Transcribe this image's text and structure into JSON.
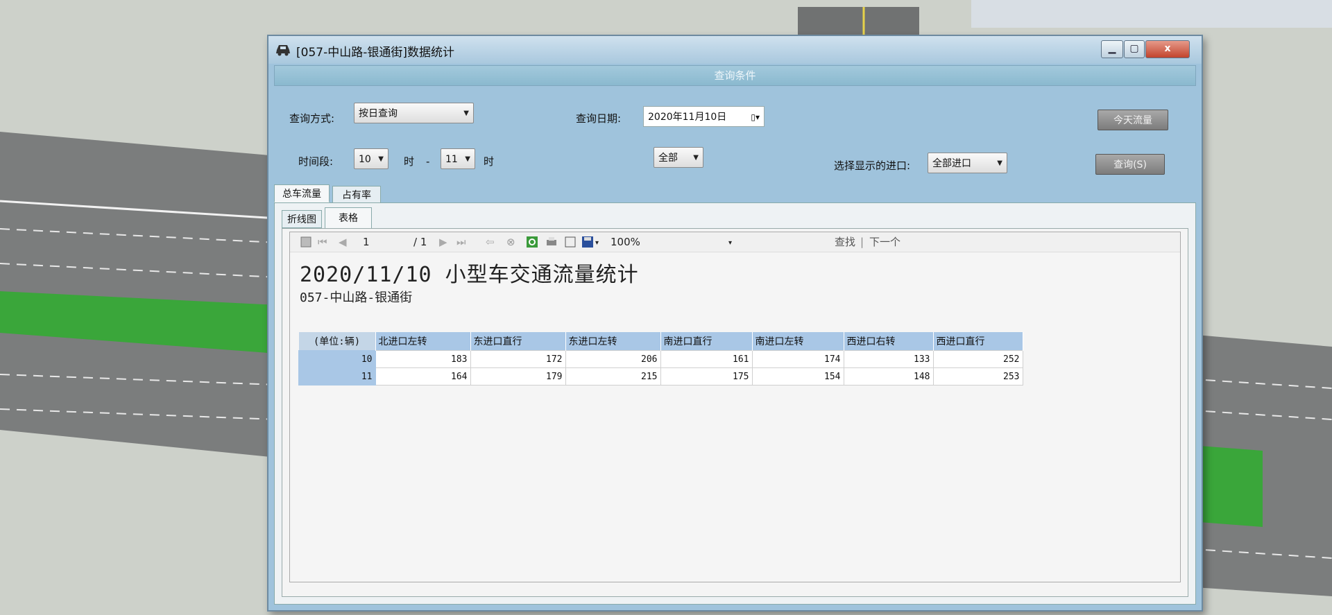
{
  "window": {
    "title": "[057-中山路-银通街]数据统计",
    "controls": {
      "minimize": "▁",
      "maximize": "▢",
      "close": "x"
    }
  },
  "query": {
    "section_title": "查询条件",
    "mode_label": "查询方式:",
    "mode_value": "按日查询",
    "date_label": "查询日期:",
    "date_value": "2020年11月10日",
    "today_button": "今天流量",
    "time_label": "时间段:",
    "hour_from": "10",
    "hour_unit_1": "时",
    "dash": "-",
    "hour_to": "11",
    "hour_unit_2": "时",
    "vehicle_value": "全部",
    "entrance_label": "选择显示的进口:",
    "entrance_value": "全部进口",
    "query_button": "查询(S)"
  },
  "tabs": {
    "outer": [
      "总车流量",
      "占有率"
    ],
    "inner": [
      "折线图",
      "表格"
    ]
  },
  "toolbar": {
    "page_current": "1",
    "page_total": "/ 1",
    "zoom": "100%",
    "find": "查找",
    "find_next": "下一个"
  },
  "report": {
    "title": "2020/11/10 小型车交通流量统计",
    "subtitle": "057-中山路-银通街",
    "unit_header": "(单位:辆)",
    "columns": [
      "北进口左转",
      "东进口直行",
      "东进口左转",
      "南进口直行",
      "南进口左转",
      "西进口右转",
      "西进口直行"
    ],
    "rows": [
      {
        "hour": "10",
        "values": [
          "183",
          "172",
          "206",
          "161",
          "174",
          "133",
          "252"
        ]
      },
      {
        "hour": "11",
        "values": [
          "164",
          "179",
          "215",
          "175",
          "154",
          "148",
          "253"
        ]
      }
    ]
  }
}
